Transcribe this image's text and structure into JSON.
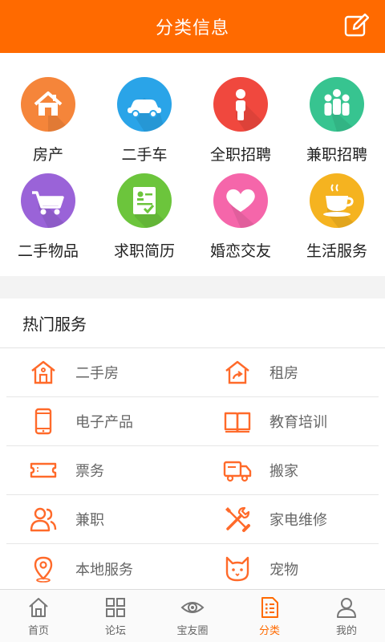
{
  "header": {
    "title": "分类信息",
    "edit_icon": "edit-icon"
  },
  "categories": [
    {
      "label": "房产",
      "color": "#f5853a",
      "icon": "house-icon"
    },
    {
      "label": "二手车",
      "color": "#2aa4e8",
      "icon": "car-icon"
    },
    {
      "label": "全职招聘",
      "color": "#f0483e",
      "icon": "person-icon"
    },
    {
      "label": "兼职招聘",
      "color": "#37c490",
      "icon": "group-icon"
    },
    {
      "label": "二手物品",
      "color": "#9a63d8",
      "icon": "cart-icon"
    },
    {
      "label": "求职简历",
      "color": "#6cc53c",
      "icon": "resume-icon"
    },
    {
      "label": "婚恋交友",
      "color": "#f566aa",
      "icon": "heart-icon"
    },
    {
      "label": "生活服务",
      "color": "#f5b320",
      "icon": "coffee-icon"
    }
  ],
  "hot": {
    "title": "热门服务",
    "accent": "#ff6a2a",
    "rows": [
      [
        {
          "label": "二手房",
          "icon": "house-icon"
        },
        {
          "label": "租房",
          "icon": "rent-house-icon"
        }
      ],
      [
        {
          "label": "电子产品",
          "icon": "phone-icon"
        },
        {
          "label": "教育培训",
          "icon": "book-icon"
        }
      ],
      [
        {
          "label": "票务",
          "icon": "ticket-icon"
        },
        {
          "label": "搬家",
          "icon": "truck-icon"
        }
      ],
      [
        {
          "label": "兼职",
          "icon": "people-icon"
        },
        {
          "label": "家电维修",
          "icon": "tools-icon"
        }
      ],
      [
        {
          "label": "本地服务",
          "icon": "location-pin-icon"
        },
        {
          "label": "宠物",
          "icon": "cat-icon"
        }
      ]
    ]
  },
  "tabs": [
    {
      "label": "首页",
      "icon": "home-icon",
      "active": false
    },
    {
      "label": "论坛",
      "icon": "grid-icon",
      "active": false
    },
    {
      "label": "宝友圈",
      "icon": "eye-icon",
      "active": false
    },
    {
      "label": "分类",
      "icon": "list-icon",
      "active": true
    },
    {
      "label": "我的",
      "icon": "user-icon",
      "active": false
    }
  ]
}
